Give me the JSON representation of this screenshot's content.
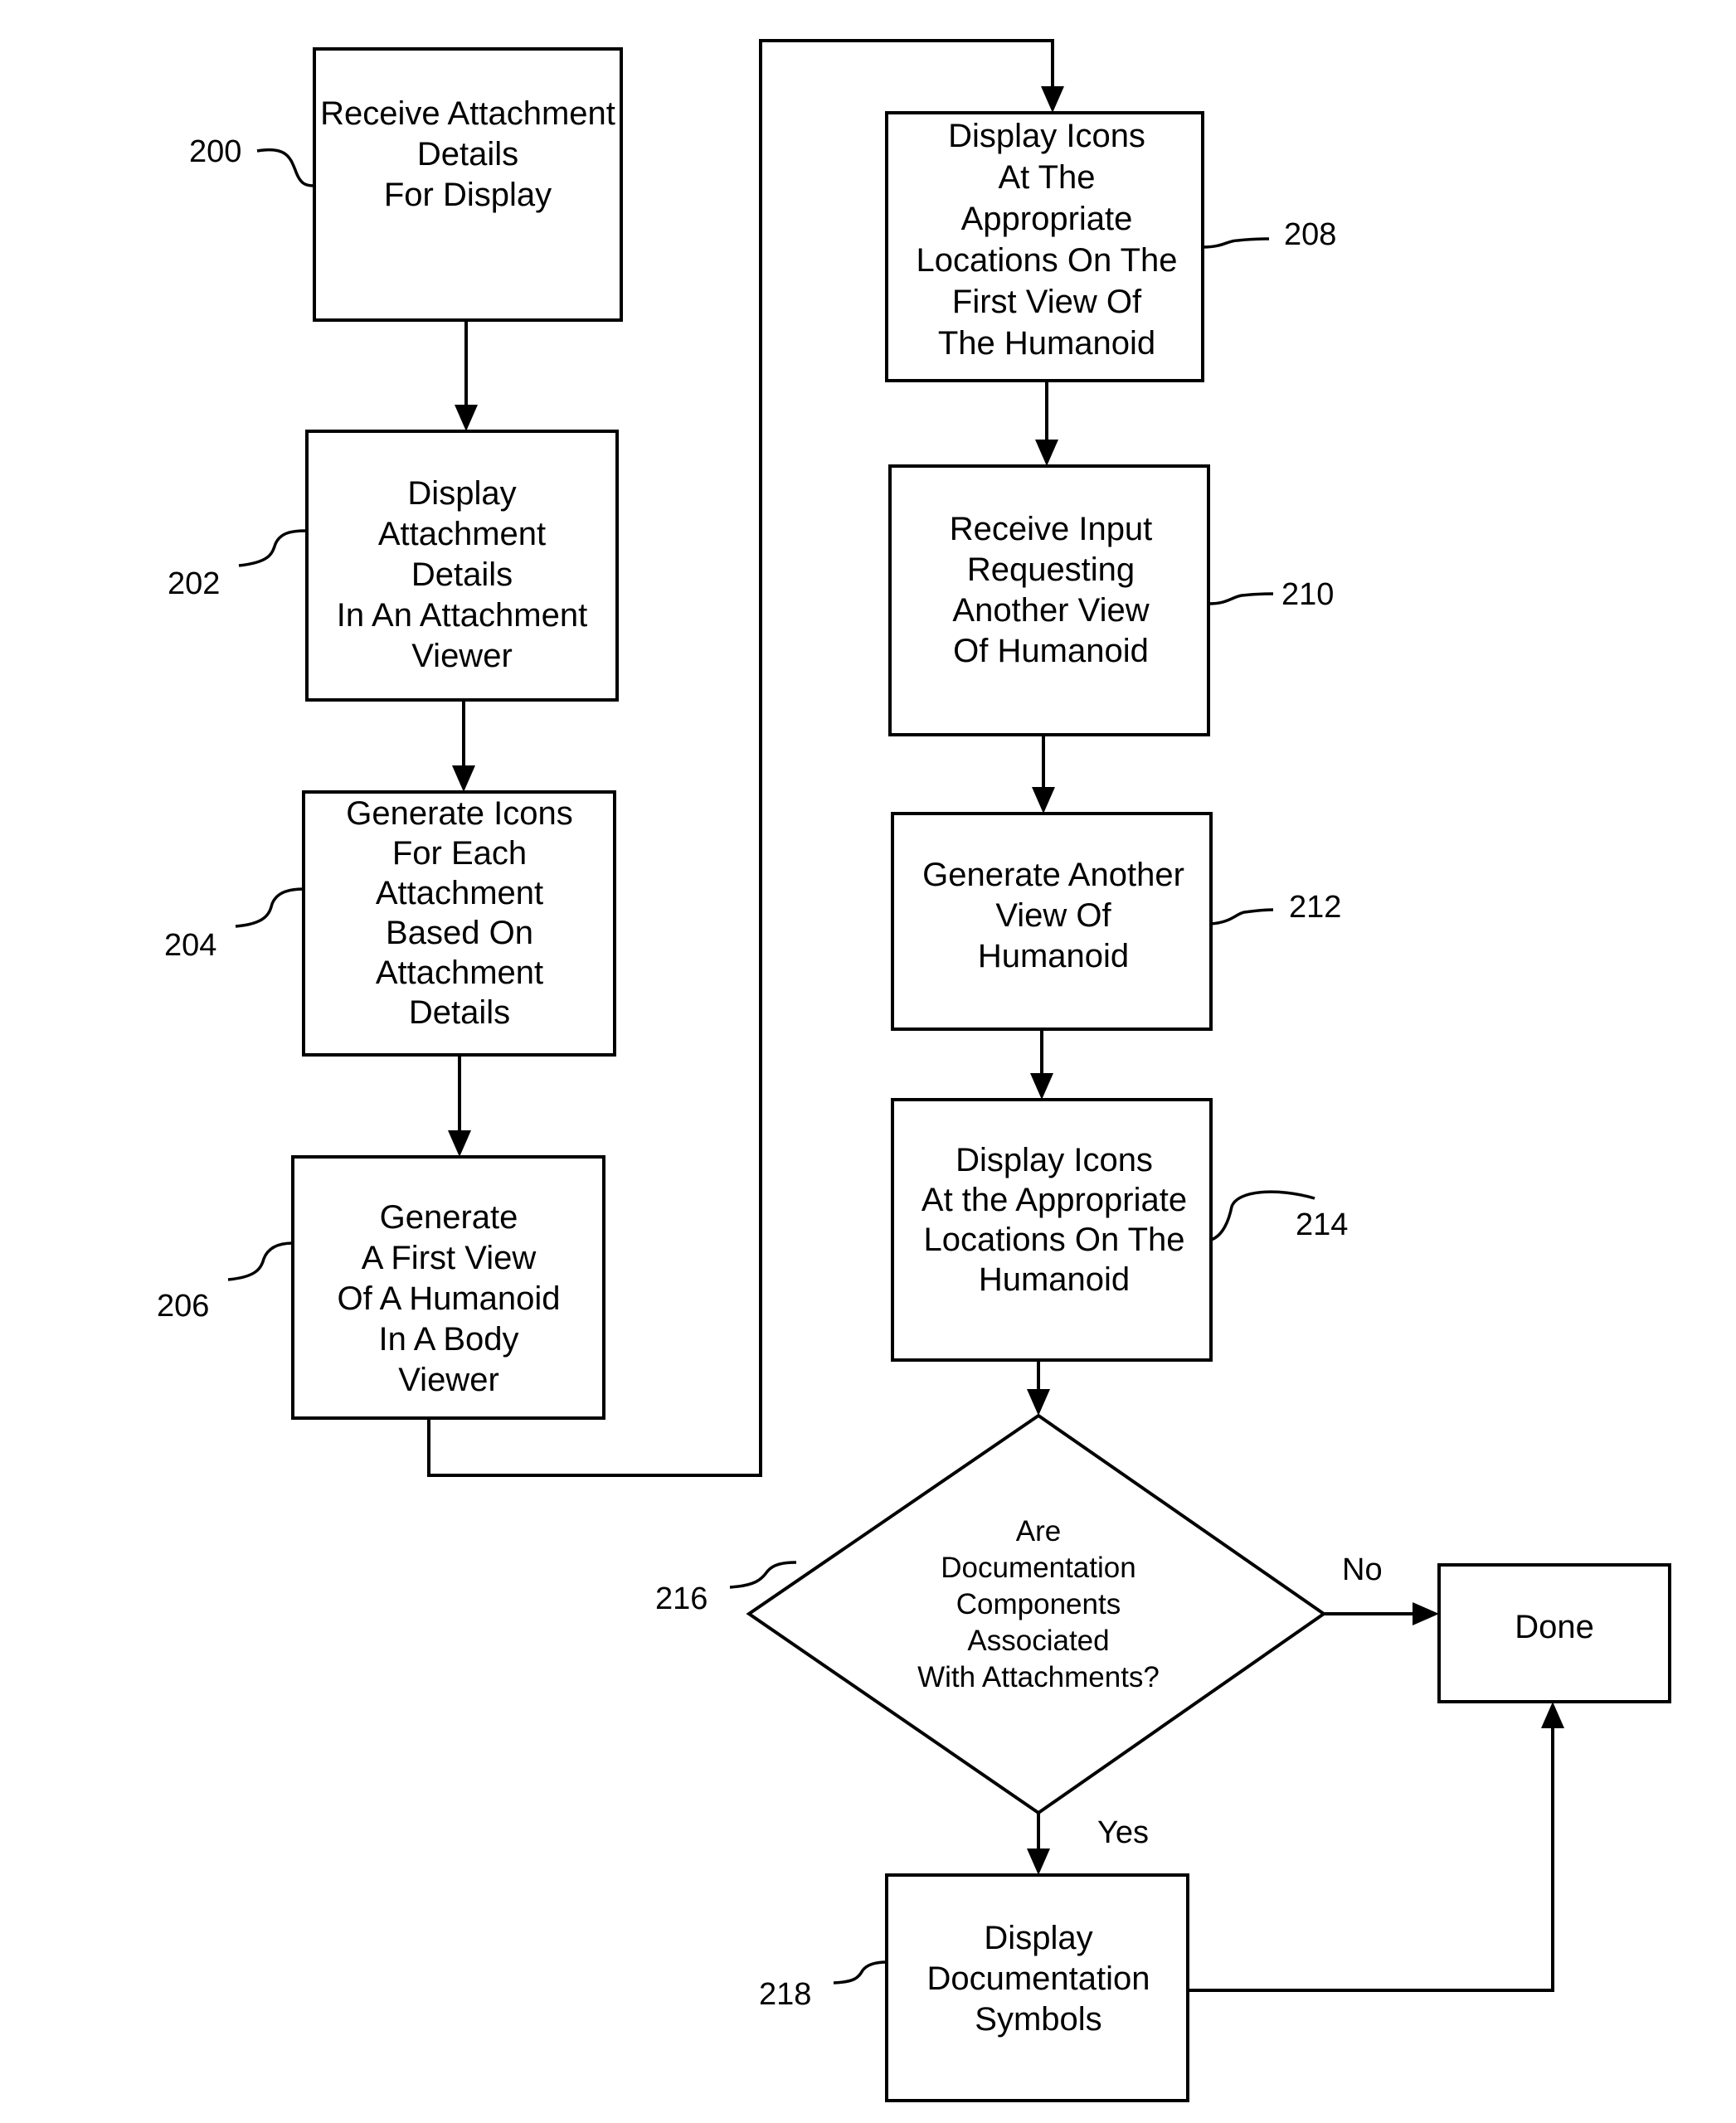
{
  "diagram": {
    "type": "flowchart",
    "nodes": [
      {
        "id": "200",
        "ref": "200",
        "shape": "process",
        "lines": [
          "Receive Attachment",
          "Details",
          "For Display"
        ]
      },
      {
        "id": "202",
        "ref": "202",
        "shape": "process",
        "lines": [
          "Display",
          "Attachment",
          "Details",
          "In An Attachment",
          "Viewer"
        ]
      },
      {
        "id": "204",
        "ref": "204",
        "shape": "process",
        "lines": [
          "Generate Icons",
          "For Each",
          "Attachment",
          "Based On",
          "Attachment",
          "Details"
        ]
      },
      {
        "id": "206",
        "ref": "206",
        "shape": "process",
        "lines": [
          "Generate",
          "A First View",
          "Of A Humanoid",
          "In A Body",
          "Viewer"
        ]
      },
      {
        "id": "208",
        "ref": "208",
        "shape": "process",
        "lines": [
          "Display Icons",
          "At The",
          "Appropriate",
          "Locations On The",
          "First View Of",
          "The Humanoid"
        ]
      },
      {
        "id": "210",
        "ref": "210",
        "shape": "process",
        "lines": [
          "Receive Input",
          "Requesting",
          "Another View",
          "Of Humanoid"
        ]
      },
      {
        "id": "212",
        "ref": "212",
        "shape": "process",
        "lines": [
          "Generate Another",
          "View Of",
          "Humanoid"
        ]
      },
      {
        "id": "214",
        "ref": "214",
        "shape": "process",
        "lines": [
          "Display Icons",
          "At the Appropriate",
          "Locations On The",
          "Humanoid"
        ]
      },
      {
        "id": "216",
        "ref": "216",
        "shape": "decision",
        "lines": [
          "Are",
          "Documentation",
          "Components",
          "Associated",
          "With Attachments?"
        ]
      },
      {
        "id": "done",
        "ref": "",
        "shape": "terminal",
        "lines": [
          "Done"
        ]
      },
      {
        "id": "218",
        "ref": "218",
        "shape": "process",
        "lines": [
          "Display",
          "Documentation",
          "Symbols"
        ]
      }
    ],
    "edges": [
      {
        "from": "200",
        "to": "202",
        "label": ""
      },
      {
        "from": "202",
        "to": "204",
        "label": ""
      },
      {
        "from": "204",
        "to": "206",
        "label": ""
      },
      {
        "from": "206",
        "to": "208",
        "label": ""
      },
      {
        "from": "208",
        "to": "210",
        "label": ""
      },
      {
        "from": "210",
        "to": "212",
        "label": ""
      },
      {
        "from": "212",
        "to": "214",
        "label": ""
      },
      {
        "from": "214",
        "to": "216",
        "label": ""
      },
      {
        "from": "216",
        "to": "done",
        "label": "No"
      },
      {
        "from": "216",
        "to": "218",
        "label": "Yes"
      },
      {
        "from": "218",
        "to": "done",
        "label": ""
      }
    ],
    "edge_labels": {
      "no": "No",
      "yes": "Yes"
    }
  }
}
